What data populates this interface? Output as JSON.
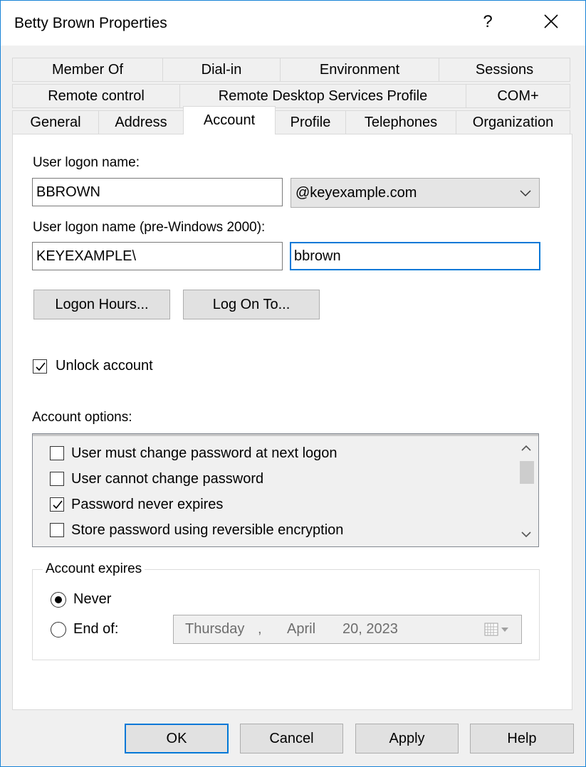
{
  "window": {
    "title": "Betty Brown Properties",
    "help_label": "?"
  },
  "tabs": {
    "row1": [
      "Member Of",
      "Dial-in",
      "Environment",
      "Sessions"
    ],
    "row2": [
      "Remote control",
      "Remote Desktop Services Profile",
      "COM+"
    ],
    "row3": [
      "General",
      "Address",
      "Account",
      "Profile",
      "Telephones",
      "Organization"
    ],
    "active": "Account"
  },
  "account": {
    "logon_label": "User logon name:",
    "logon_value": "BBROWN",
    "domain_value": "@keyexample.com",
    "pre2000_label": "User logon name (pre-Windows 2000):",
    "pre2000_domain": "KEYEXAMPLE\\",
    "pre2000_user": "bbrown",
    "logon_hours_btn": "Logon Hours...",
    "log_on_to_btn": "Log On To...",
    "unlock_label": "Unlock account",
    "unlock_checked": true,
    "options_label": "Account options:",
    "options": [
      {
        "label": "User must change password at next logon",
        "checked": false
      },
      {
        "label": "User cannot change password",
        "checked": false
      },
      {
        "label": "Password never expires",
        "checked": true
      },
      {
        "label": "Store password using reversible encryption",
        "checked": false
      }
    ],
    "expires_label": "Account expires",
    "never_label": "Never",
    "end_of_label": "End of:",
    "expires_selected": "Never",
    "date": {
      "weekday": "Thursday",
      "sep": ",",
      "month": "April",
      "day_year": "20, 2023"
    }
  },
  "footer": {
    "ok": "OK",
    "cancel": "Cancel",
    "apply": "Apply",
    "help": "Help"
  }
}
